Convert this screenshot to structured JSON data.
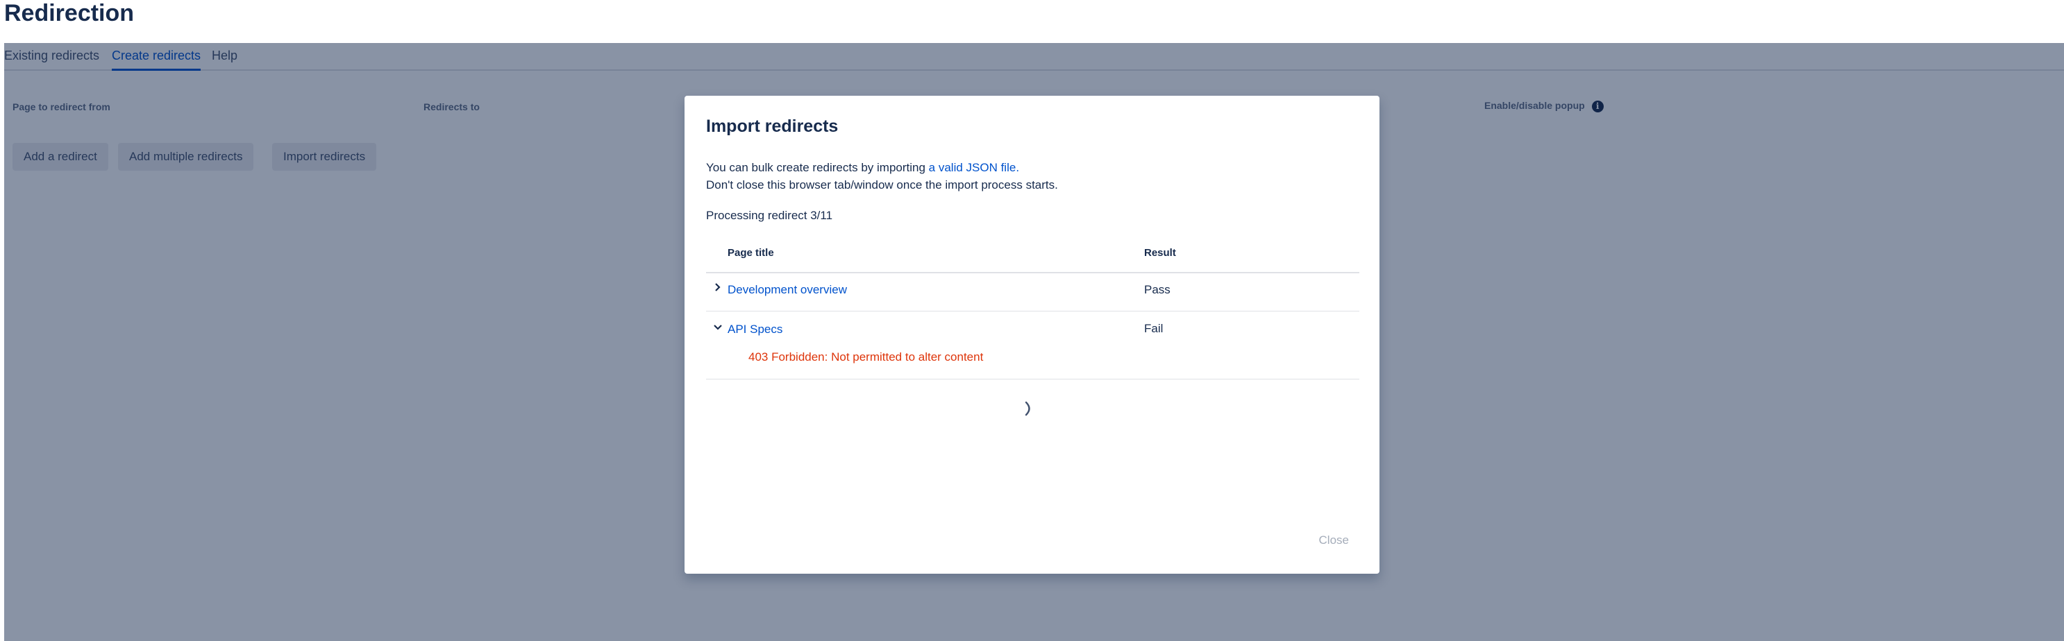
{
  "page": {
    "title": "Redirection"
  },
  "tabs": [
    {
      "label": "Existing redirects",
      "active": false
    },
    {
      "label": "Create redirects",
      "active": true
    },
    {
      "label": "Help",
      "active": false
    }
  ],
  "columns": {
    "from": "Page to redirect from",
    "to": "Redirects to",
    "popup": "Enable/disable popup",
    "popup_icon": "info-icon"
  },
  "actions": {
    "add": "Add a redirect",
    "add_multiple": "Add multiple redirects",
    "import": "Import redirects"
  },
  "modal": {
    "title": "Import redirects",
    "intro_prefix": "You can bulk create redirects by importing ",
    "intro_link": "a valid JSON file.",
    "warning": "Don't close this browser tab/window once the import process starts.",
    "progress": "Processing redirect 3/11",
    "table_headers": {
      "title": "Page title",
      "result": "Result"
    },
    "rows": [
      {
        "title": "Development overview",
        "result": "Pass",
        "expanded": false,
        "error": ""
      },
      {
        "title": "API Specs",
        "result": "Fail",
        "expanded": true,
        "error": "403 Forbidden: Not permitted to alter content"
      }
    ],
    "close_label": "Close",
    "spinner_icon": "loading-spinner-icon"
  },
  "colors": {
    "link": "#0052cc",
    "error": "#de350b",
    "overlay": "rgba(9,30,66,0.48)",
    "disabled": "#a5adba"
  }
}
